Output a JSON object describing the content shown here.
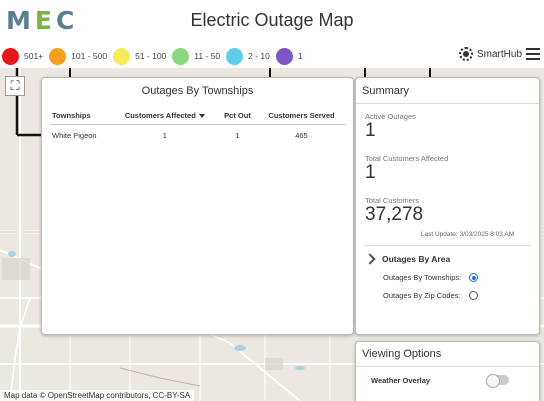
{
  "header": {
    "logo": "MEC",
    "title": "Electric Outage Map"
  },
  "legend": [
    {
      "label": "501+",
      "color": "#e8161b"
    },
    {
      "label": "101 - 500",
      "color": "#f59f1c"
    },
    {
      "label": "51 - 100",
      "color": "#f6ec5b"
    },
    {
      "label": "11 - 50",
      "color": "#89d97e"
    },
    {
      "label": "2 - 10",
      "color": "#62ccec"
    },
    {
      "label": "1",
      "color": "#7e57c2"
    }
  ],
  "nav": {
    "smarthub_label": "SmartHub"
  },
  "townships": {
    "title": "Outages By Townships",
    "columns": [
      "Townships",
      "Customers Affected",
      "Pct Out",
      "Customers Served"
    ],
    "rows": [
      {
        "township": "White Pigeon",
        "affected": "1",
        "pct_out": "1",
        "served": "465"
      }
    ]
  },
  "summary": {
    "title": "Summary",
    "active_outages_label": "Active Outages",
    "active_outages": "1",
    "total_affected_label": "Total Customers Affected",
    "total_affected": "1",
    "total_customers_label": "Total Customers",
    "total_customers": "37,278",
    "last_update": "Last Update: 3/03/2025 8:03 AM",
    "by_area_label": "Outages By Area",
    "options": [
      {
        "label": "Outages By Townships:",
        "checked": true
      },
      {
        "label": "Outages By Zip Codes:",
        "checked": false
      }
    ]
  },
  "viewing": {
    "title": "Viewing Options",
    "weather_label": "Weather Overlay"
  },
  "map": {
    "attribution": "Map data © OpenStreetMap contributors, CC-BY-SA",
    "expand_glyph": "⛶"
  }
}
